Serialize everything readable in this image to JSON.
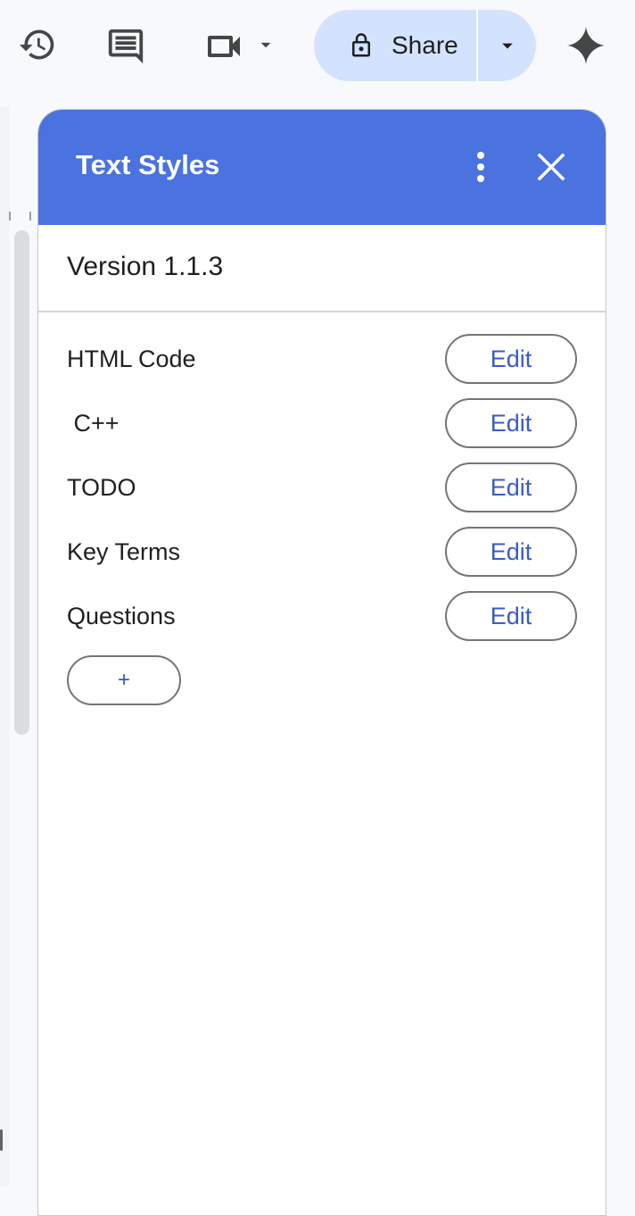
{
  "toolbar": {
    "history_icon": "history-icon",
    "comments_icon": "comment-icon",
    "meet_icon": "video-camera-icon",
    "meet_dropdown_icon": "caret-down-icon",
    "share": {
      "label": "Share",
      "icon": "lock-icon",
      "dropdown_icon": "caret-down-icon"
    },
    "gemini_icon": "sparkle-icon"
  },
  "panel": {
    "title": "Text Styles",
    "more_icon": "more-vert-icon",
    "close_icon": "close-icon",
    "version": "Version 1.1.3",
    "styles": [
      {
        "name": "HTML Code",
        "action": "Edit"
      },
      {
        "name": " C++",
        "action": "Edit"
      },
      {
        "name": "TODO",
        "action": "Edit"
      },
      {
        "name": "Key Terms",
        "action": "Edit"
      },
      {
        "name": "Questions",
        "action": "Edit"
      }
    ],
    "add_label": "+"
  },
  "colors": {
    "header_bg": "#4a73e0",
    "share_bg": "#d3e3fd",
    "button_text": "#3c5ac2",
    "icon": "#444746"
  }
}
